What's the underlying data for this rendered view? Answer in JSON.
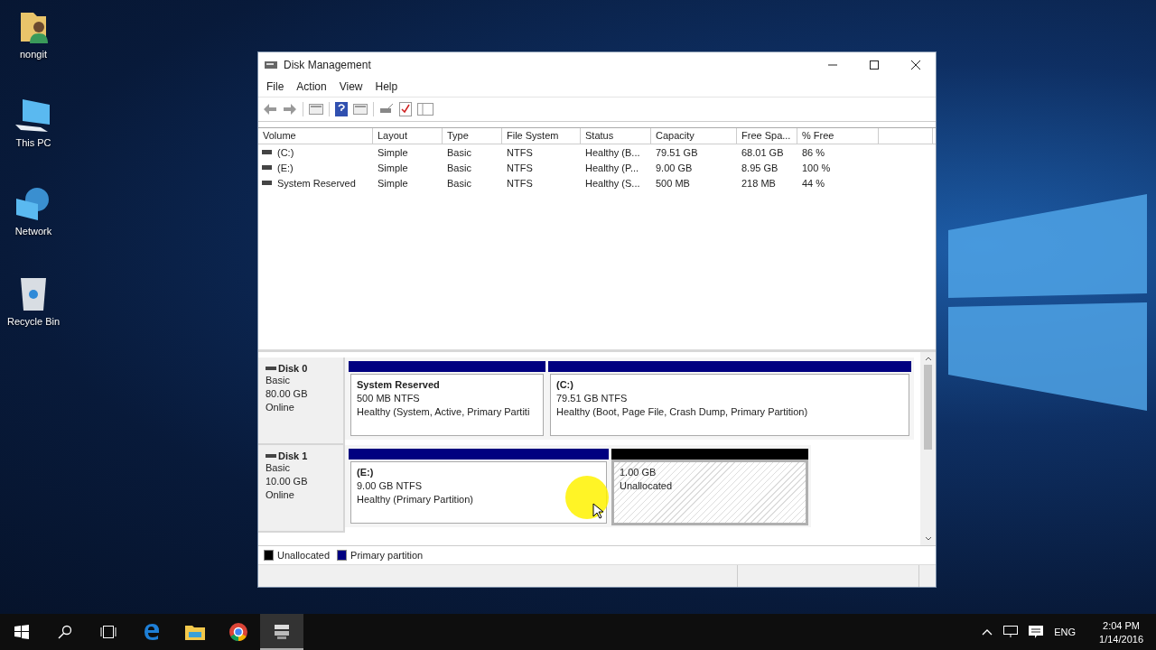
{
  "desktop_icons": [
    {
      "label": "nongit",
      "kind": "user"
    },
    {
      "label": "This PC",
      "kind": "pc"
    },
    {
      "label": "Network",
      "kind": "network"
    },
    {
      "label": "Recycle Bin",
      "kind": "bin"
    }
  ],
  "window": {
    "title": "Disk Management",
    "menu": [
      "File",
      "Action",
      "View",
      "Help"
    ],
    "volume_table": {
      "columns": [
        "Volume",
        "Layout",
        "Type",
        "File System",
        "Status",
        "Capacity",
        "Free Spa...",
        "% Free"
      ],
      "rows": [
        [
          "(C:)",
          "Simple",
          "Basic",
          "NTFS",
          "Healthy (B...",
          "79.51 GB",
          "68.01 GB",
          "86 %"
        ],
        [
          "(E:)",
          "Simple",
          "Basic",
          "NTFS",
          "Healthy (P...",
          "9.00 GB",
          "8.95 GB",
          "100 %"
        ],
        [
          "System Reserved",
          "Simple",
          "Basic",
          "NTFS",
          "Healthy (S...",
          "500 MB",
          "218 MB",
          "44 %"
        ]
      ]
    },
    "disks": [
      {
        "name": "Disk 0",
        "type": "Basic",
        "size": "80.00 GB",
        "state": "Online",
        "partitions": [
          {
            "kind": "primary",
            "color": "#000080",
            "selected": false,
            "title": "System Reserved",
            "size": "500 MB NTFS",
            "status": "Healthy (System, Active, Primary Partiti"
          },
          {
            "kind": "primary",
            "color": "#000080",
            "selected": false,
            "title": "(C:)",
            "size": "79.51 GB NTFS",
            "status": "Healthy (Boot, Page File, Crash Dump, Primary Partition)"
          }
        ]
      },
      {
        "name": "Disk 1",
        "type": "Basic",
        "size": "10.00 GB",
        "state": "Online",
        "partitions": [
          {
            "kind": "primary",
            "color": "#000080",
            "selected": false,
            "title": "(E:)",
            "size": "9.00 GB NTFS",
            "status": "Healthy (Primary Partition)"
          },
          {
            "kind": "unallocated",
            "color": "#000000",
            "selected": true,
            "size": "1.00 GB",
            "status": "Unallocated"
          }
        ]
      }
    ],
    "legend": [
      {
        "label": "Unallocated",
        "color": "#000000"
      },
      {
        "label": "Primary partition",
        "color": "#000080"
      }
    ]
  },
  "taskbar": {
    "apps": [
      {
        "kind": "edge",
        "selected": false
      },
      {
        "kind": "explorer",
        "selected": false
      },
      {
        "kind": "chrome",
        "selected": false
      },
      {
        "kind": "diskmgmt",
        "selected": true
      }
    ],
    "language": "ENG",
    "time": "2:04 PM",
    "date": "1/14/2016"
  }
}
